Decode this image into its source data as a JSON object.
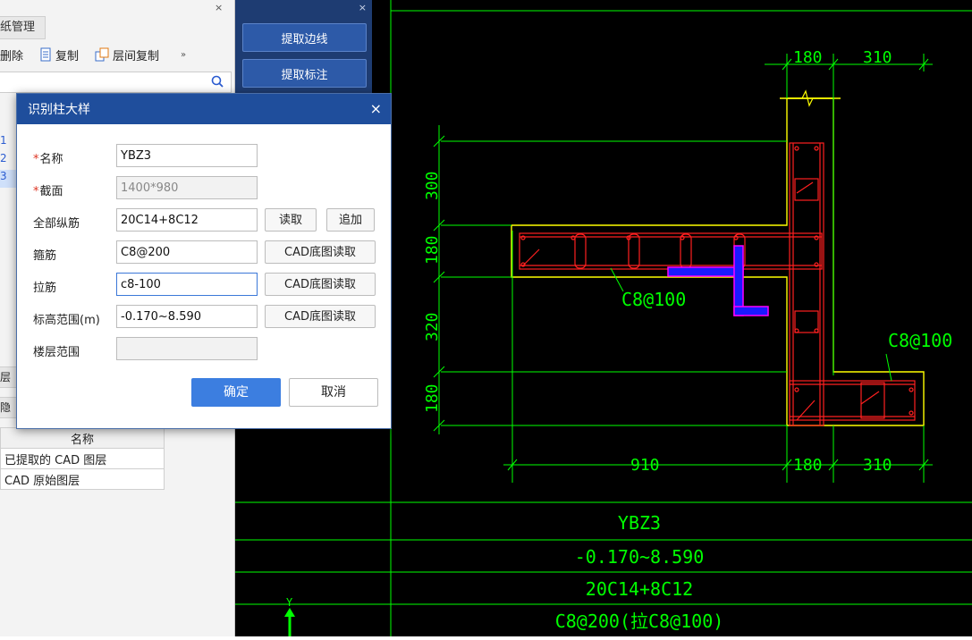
{
  "left_panel": {
    "close_glyph": "×",
    "tab_label": "纸管理",
    "toolbar": {
      "delete_label": "删除",
      "copy_label": "复制",
      "floor_copy_label": "层间复制",
      "more_glyph": "»"
    },
    "strip_text": [
      "1",
      "2",
      "3"
    ],
    "side_tabs": [
      "层管",
      "隐藏"
    ],
    "layer_table": {
      "header": "名称",
      "rows": [
        "已提取的 CAD 图层",
        "CAD 原始图层"
      ]
    }
  },
  "mid_panel": {
    "close_glyph": "×",
    "extract_edge_label": "提取边线",
    "extract_annotation_label": "提取标注"
  },
  "dialog": {
    "title": "识别柱大样",
    "close_glyph": "×",
    "fields": {
      "name": {
        "label": "名称",
        "value": "YBZ3",
        "required": true
      },
      "section": {
        "label": "截面",
        "value": "1400*980",
        "required": true
      },
      "longitudinal": {
        "label": "全部纵筋",
        "value": "20C14+8C12",
        "read_label": "读取",
        "append_label": "追加"
      },
      "stirrup": {
        "label": "箍筋",
        "value": "C8@200",
        "button_label": "CAD底图读取"
      },
      "tie": {
        "label": "拉筋",
        "value": "c8-100",
        "button_label": "CAD底图读取"
      },
      "elevation": {
        "label": "标高范围(m)",
        "value": "-0.170~8.590",
        "button_label": "CAD底图读取"
      },
      "floor_range": {
        "label": "楼层范围",
        "value": ""
      }
    },
    "ok_label": "确定",
    "cancel_label": "取消"
  },
  "cad": {
    "dims_top": [
      "180",
      "310"
    ],
    "dims_bottom": [
      "910",
      "180",
      "310"
    ],
    "dims_left": [
      "300",
      "180",
      "320",
      "180"
    ],
    "annotation_1": "C8@100",
    "annotation_2": "C8@100",
    "table_rows": [
      "YBZ3",
      "-0.170~8.590",
      "20C14+8C12",
      "C8@200(拉C8@100)"
    ],
    "axis_y_label": "Y"
  },
  "colors": {
    "cad_green": "#00ff00",
    "cad_yellow": "#ffff00",
    "cad_red": "#ff2020",
    "highlight_blue": "#1a1aff",
    "highlight_magenta": "#ff00ff"
  }
}
